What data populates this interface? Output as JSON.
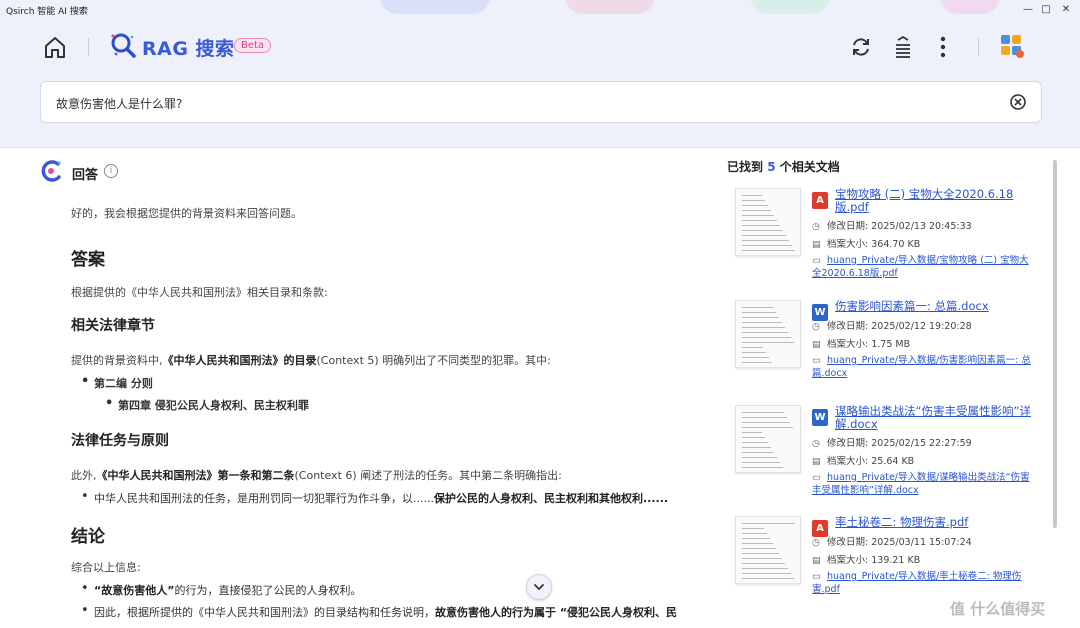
{
  "window": {
    "title": "Qsirch 智能 AI 搜索",
    "controls": {
      "minimize": "—",
      "maximize": "□",
      "close": "✕"
    }
  },
  "header": {
    "title": "RAG 搜索",
    "badge": "Beta",
    "icons": [
      "home-icon",
      "refresh-icon",
      "history-icon",
      "more-icon",
      "avatar-icon"
    ]
  },
  "search": {
    "query": "故意伤害他人是什么罪?"
  },
  "answer": {
    "label": "回答",
    "intro": "好的，我会根据您提供的背景资料来回答问题。",
    "h_answer": "答案",
    "p1": "根据提供的《中华人民共和国刑法》相关目录和条款:",
    "h_chapters": "相关法律章节",
    "p2_a": "提供的背景资料中,",
    "p2_b": "《中华人民共和国刑法》的目录",
    "p2_c": "(Context 5) 明确列出了不同类型的犯罪。其中:",
    "b1": "第二编 分则",
    "b1_1": "第四章 侵犯公民人身权利、民主权利罪",
    "h_principles": "法律任务与原则",
    "p3_a": "此外,",
    "p3_b": "《中华人民共和国刑法》第一条和第二条",
    "p3_c": "(Context 6) 阐述了刑法的任务。其中第二条明确指出:",
    "b2_a": "中华人民共和国刑法的任务，是用刑罚同一切犯罪行为作斗争，以......",
    "b2_b": "保护公民的人身权利、民主权利和其他权利......",
    "h_conclusion": "结论",
    "p4": "综合以上信息:",
    "b3_a": "“故意伤害他人”",
    "b3_b": "的行为，直接侵犯了公民的人身权利。",
    "b4_a": "因此，根据所提供的《中华人民共和国刑法》的目录结构和任务说明，",
    "b4_b": "故意伤害他人的行为属于 “侵犯公民人身权利、民"
  },
  "docs": {
    "heading_pre": "已找到",
    "count": "5",
    "heading_post": "个相关文档",
    "modified_label": "修改日期:",
    "size_label": "档案大小:",
    "items": [
      {
        "type": "pdf",
        "type_glyph": "A",
        "name": "宝物攻略 (二) 宝物大全2020.6.18版.pdf",
        "modified": "2025/02/13 20:45:33",
        "size": "364.70 KB",
        "path": "huang_Private/导入数据/宝物攻略 (二) 宝物大全2020.6.18版.pdf"
      },
      {
        "type": "word",
        "type_glyph": "W",
        "name": "伤害影响因素篇一: 总篇.docx",
        "modified": "2025/02/12 19:20:28",
        "size": "1.75 MB",
        "path": "huang_Private/导入数据/伤害影响因素篇一: 总篇.docx"
      },
      {
        "type": "word",
        "type_glyph": "W",
        "name": "谋略输出类战法“伤害丰受属性影响”详解.docx",
        "modified": "2025/02/15 22:27:59",
        "size": "25.64 KB",
        "path": "huang_Private/导入数据/谋略输出类战法“伤害丰受属性影响”详解.docx"
      },
      {
        "type": "pdf",
        "type_glyph": "A",
        "name": "率土秘卷二: 物理伤害.pdf",
        "modified": "2025/03/11 15:07:24",
        "size": "139.21 KB",
        "path": "huang_Private/导入数据/率土秘卷二: 物理伤害.pdf"
      }
    ]
  },
  "watermark": "值 什么值得买",
  "colors": {
    "accent": "#3b5bd6",
    "link": "#2a55d1",
    "pdf": "#e0392b",
    "word": "#2b66c8",
    "header_bg": "#eef0fb",
    "beta": "#d2408b"
  }
}
